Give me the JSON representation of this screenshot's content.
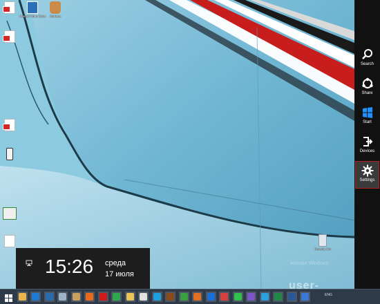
{
  "desktop": {
    "icons": [
      {
        "label": "",
        "kind": "doc-red"
      },
      {
        "label": "Movavi Video Suite",
        "kind": "app-blue"
      },
      {
        "label": "Cortana",
        "kind": "app-cup"
      },
      {
        "label": "",
        "kind": "doc-red"
      },
      {
        "label": "",
        "kind": "doc-red"
      },
      {
        "label": "",
        "kind": "phone"
      },
      {
        "label": "",
        "kind": "sheet"
      },
      {
        "label": "",
        "kind": "doc"
      },
      {
        "label": "Recycle Bin",
        "kind": "trash"
      }
    ],
    "activation_text": "Activate Windows",
    "watermark": "user-life.com"
  },
  "clock": {
    "time": "15:26",
    "day": "среда",
    "date": "17 июля"
  },
  "charms": [
    {
      "label": "Search",
      "icon": "search-icon"
    },
    {
      "label": "Share",
      "icon": "share-icon"
    },
    {
      "label": "Start",
      "icon": "windows-logo-icon"
    },
    {
      "label": "Devices",
      "icon": "devices-icon"
    },
    {
      "label": "Settings",
      "icon": "gear-icon",
      "active": true
    }
  ],
  "taskbar": {
    "items": [
      {
        "name": "start-button",
        "color": "#ffffff"
      },
      {
        "name": "file-explorer-icon",
        "color": "#e8b54a"
      },
      {
        "name": "desktop-icon",
        "color": "#1f7ad6"
      },
      {
        "name": "remote-desktop-icon",
        "color": "#2a6bb0"
      },
      {
        "name": "media-player-icon",
        "color": "#9bb2c8"
      },
      {
        "name": "archive-icon",
        "color": "#c8a060"
      },
      {
        "name": "firefox-icon",
        "color": "#e86a1c"
      },
      {
        "name": "opera-icon",
        "color": "#d01b1b"
      },
      {
        "name": "chrome-icon",
        "color": "#2fa84f"
      },
      {
        "name": "folder-icon",
        "color": "#e8c35a"
      },
      {
        "name": "document-icon",
        "color": "#e0e0e0"
      },
      {
        "name": "skype-icon",
        "color": "#1ea0e0"
      },
      {
        "name": "app-brown-icon",
        "color": "#8a4a1a"
      },
      {
        "name": "app-green-icon",
        "color": "#3aa040"
      },
      {
        "name": "app-orange-icon",
        "color": "#e07020"
      },
      {
        "name": "teamviewer-icon",
        "color": "#1c6fd8"
      },
      {
        "name": "app-red-green-icon",
        "color": "#d84040"
      },
      {
        "name": "whatsapp-icon",
        "color": "#2ec24a"
      },
      {
        "name": "viber-icon",
        "color": "#7b56c8"
      },
      {
        "name": "telegram-icon",
        "color": "#2ba0dc"
      },
      {
        "name": "excel-icon",
        "color": "#1f8a45"
      },
      {
        "name": "word-icon",
        "color": "#2b5797"
      },
      {
        "name": "app-blue-icon",
        "color": "#3a7ad6"
      }
    ],
    "tray_text": "ENG"
  }
}
